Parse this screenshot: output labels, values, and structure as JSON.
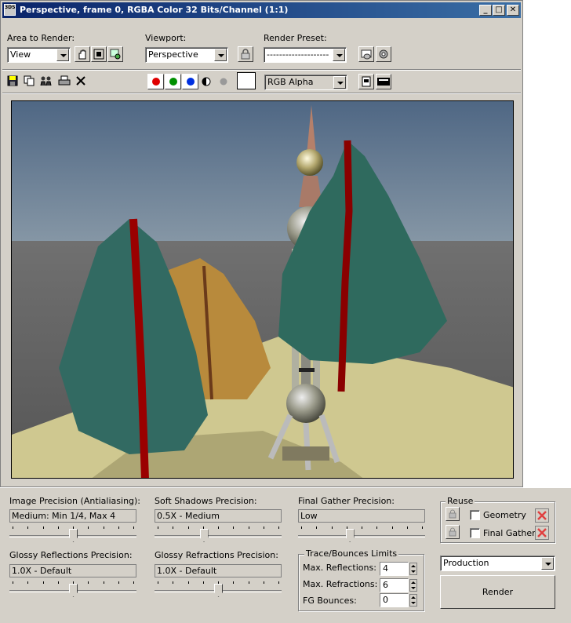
{
  "window": {
    "title": "Perspective, frame 0, RGBA Color 32 Bits/Channel (1:1)",
    "icon_text": "3DS",
    "minimize_icon": "minimize-icon",
    "maximize_icon": "maximize-icon",
    "close_icon": "close-icon"
  },
  "top": {
    "area_label": "Area to Render:",
    "area_value": "View",
    "viewport_label": "Viewport:",
    "viewport_value": "Perspective",
    "preset_label": "Render Preset:",
    "preset_value": "--------------------"
  },
  "toolbar": {
    "channel_value": "RGB Alpha",
    "colors": {
      "red": "#e00000",
      "green": "#009000",
      "blue": "#0030e0"
    }
  },
  "settings": {
    "image_precision_label": "Image Precision (Antialiasing):",
    "image_precision_value": "Medium: Min 1/4, Max 4",
    "image_precision_level": 0.5,
    "soft_shadows_label": "Soft Shadows Precision:",
    "soft_shadows_value": "0.5X - Medium",
    "soft_shadows_level": 0.38,
    "final_gather_label": "Final Gather Precision:",
    "final_gather_value": "Low",
    "final_gather_level": 0.4,
    "glossy_reflections_label": "Glossy Reflections Precision:",
    "glossy_reflections_value": "1.0X - Default",
    "glossy_reflections_level": 0.5,
    "glossy_refractions_label": "Glossy Refractions Precision:",
    "glossy_refractions_value": "1.0X - Default",
    "glossy_refractions_level": 0.5,
    "trace_label": "Trace/Bounces Limits",
    "max_reflections_label": "Max. Reflections:",
    "max_reflections_value": "4",
    "max_refractions_label": "Max. Refractions:",
    "max_refractions_value": "6",
    "fg_bounces_label": "FG Bounces:",
    "fg_bounces_value": "0",
    "reuse_label": "Reuse",
    "geometry_label": "Geometry",
    "final_gather_reuse_label": "Final Gather",
    "production_value": "Production",
    "render_label": "Render"
  }
}
